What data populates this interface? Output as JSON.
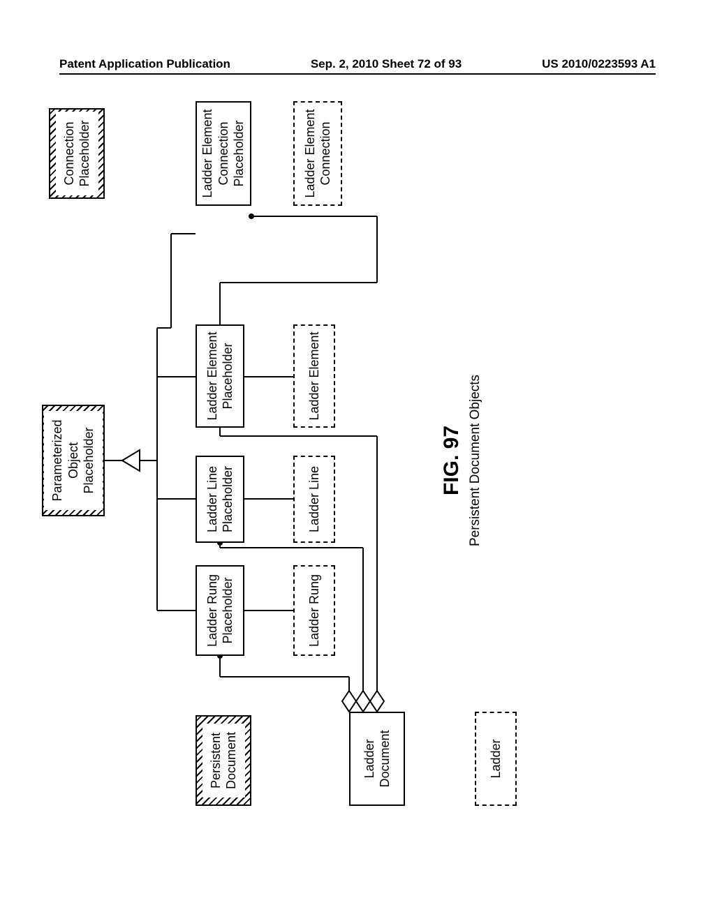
{
  "header": {
    "left": "Patent Application Publication",
    "center": "Sep. 2, 2010  Sheet 72 of 93",
    "right": "US 2010/0223593 A1"
  },
  "boxes": {
    "persistent_document": "Persistent\nDocument",
    "parameterized_object_placeholder": "Parameterized\nObject\nPlaceholder",
    "connection_placeholder": "Connection\nPlaceholder",
    "ladder_document": "Ladder\nDocument",
    "ladder_rung_placeholder": "Ladder Rung\nPlaceholder",
    "ladder_line_placeholder": "Ladder Line\nPlaceholder",
    "ladder_element_placeholder": "Ladder Element\nPlaceholder",
    "ladder_element_connection_placeholder": "Ladder Element\nConnection\nPlaceholder",
    "ladder": "Ladder",
    "ladder_rung": "Ladder Rung",
    "ladder_line": "Ladder Line",
    "ladder_element": "Ladder Element",
    "ladder_element_connection": "Ladder Element\nConnection"
  },
  "figure": {
    "label": "FIG. 97",
    "subtitle": "Persistent Document Objects"
  }
}
